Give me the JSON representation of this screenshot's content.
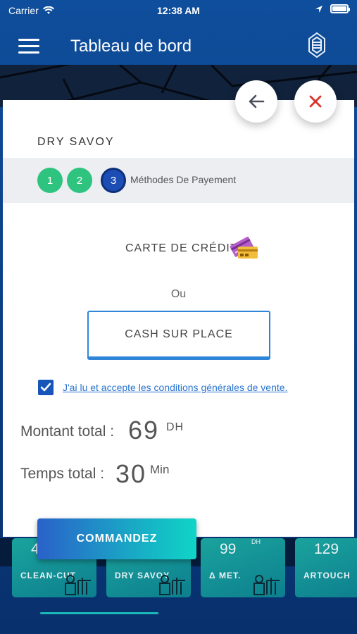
{
  "status_bar": {
    "carrier": "Carrier",
    "time": "12:38 AM"
  },
  "header": {
    "title": "Tableau de bord"
  },
  "shop": {
    "name": "DRY SAVOY"
  },
  "steps": {
    "items": [
      {
        "number": "1"
      },
      {
        "number": "2"
      },
      {
        "number": "3"
      }
    ],
    "current_label": "Méthodes De Payement"
  },
  "payment": {
    "credit_label": "CARTE DE CRÉDIT",
    "or_label": "Ou",
    "cash_label": "CASH SUR PLACE"
  },
  "terms": {
    "checked": true,
    "label": "J'ai lu et accepte les conditions générales de vente."
  },
  "totals": {
    "amount_label": "Montant total :",
    "amount_value": "69",
    "amount_unit": "DH",
    "time_label": "Temps total :",
    "time_value": "30",
    "time_unit": "Min"
  },
  "order_button": {
    "label": "COMMANDEZ"
  },
  "tiles": [
    {
      "price": "4",
      "name": "CLEAN-CUT"
    },
    {
      "price": "",
      "name": "DRY SAVOY"
    },
    {
      "price": "99",
      "sup": "DH",
      "name": "Δ MET."
    },
    {
      "price": "129",
      "name": "ARTOUCH"
    }
  ],
  "colors": {
    "header_bg": "#0f4e9c",
    "step_done": "#2ec37e",
    "step_current": "#1b4db4",
    "link": "#2a74cf",
    "close": "#d9342b"
  }
}
